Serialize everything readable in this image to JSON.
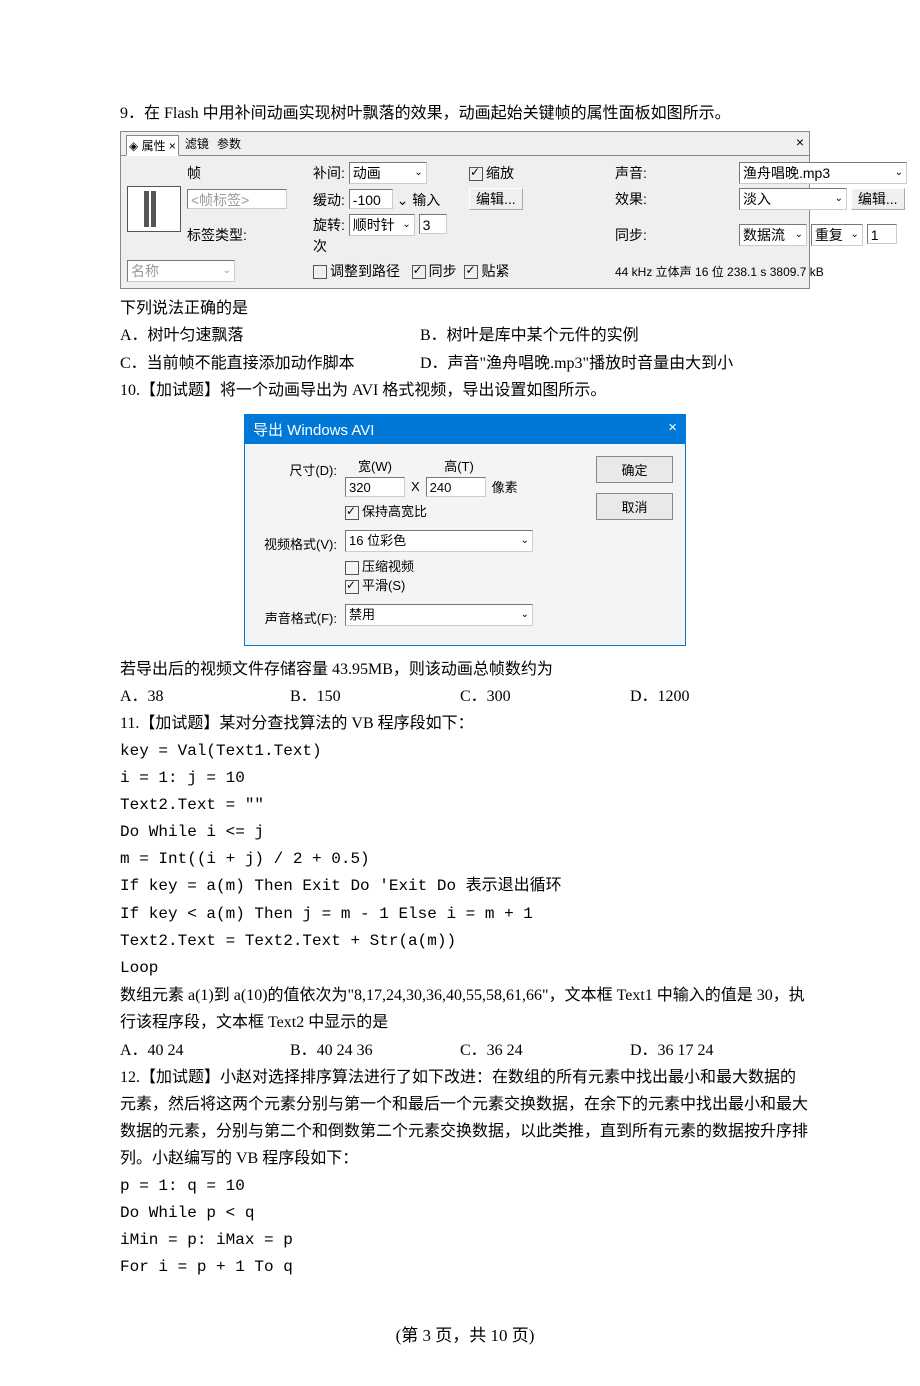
{
  "q9": {
    "text": "9．在 Flash 中用补间动画实现树叶飘落的效果，动画起始关键帧的属性面板如图所示。",
    "prompt": "下列说法正确的是",
    "opts": {
      "a": "A．树叶匀速飘落",
      "b": "B．树叶是库中某个元件的实例",
      "c": "C．当前帧不能直接添加动作脚本",
      "d": "D．声音\"渔舟唱晚.mp3\"播放时音量由大到小"
    }
  },
  "flash": {
    "tab1": "属性",
    "tab2": "滤镜",
    "tab3": "参数",
    "close": "×",
    "frame_label": "帧",
    "tag_placeholder": "<帧标签>",
    "tween_label": "补间:",
    "tween_value": "动画",
    "scale": "缩放",
    "ease_label": "缓动:",
    "ease_value": "-100",
    "ease_in": "输入",
    "edit": "编辑...",
    "rotate_label": "旋转:",
    "rotate_value": "顺时针",
    "rotate_count": "3",
    "rotate_unit": "次",
    "labeltype_label": "标签类型:",
    "name_placeholder": "名称",
    "adjust_path": "调整到路径",
    "sync": "同步",
    "snap": "贴紧",
    "sound_label": "声音:",
    "sound_value": "渔舟唱晚.mp3",
    "effect_label": "效果:",
    "effect_value": "淡入",
    "loop_label": "同步:",
    "sync_value": "数据流",
    "loop_value": "重复",
    "loop_count": "1",
    "info": "44 kHz 立体声 16 位 238.1 s 3809.7 kB"
  },
  "q10": {
    "text": "10.【加试题】将一个动画导出为 AVI 格式视频，导出设置如图所示。",
    "prompt": "若导出后的视频文件存储容量 43.95MB，则该动画总帧数约为",
    "opts": {
      "a": "A．38",
      "b": "B．150",
      "c": "C．300",
      "d": "D．1200"
    }
  },
  "avi": {
    "title": "导出 Windows AVI",
    "close": "×",
    "ok": "确定",
    "cancel": "取消",
    "size_label": "尺寸(D):",
    "w_label": "宽(W)",
    "h_label": "高(T)",
    "width": "320",
    "height": "240",
    "x": "X",
    "unit": "像素",
    "keep_ratio": "保持高宽比",
    "vf_label": "视频格式(V):",
    "vf_value": "16 位彩色",
    "compress": "压缩视频",
    "smooth": "平滑(S)",
    "af_label": "声音格式(F):",
    "af_value": "禁用"
  },
  "q11": {
    "text": "11.【加试题】某对分查找算法的 VB 程序段如下：",
    "code": [
      "key = Val(Text1.Text)",
      "i = 1: j = 10",
      "Text2.Text = \"\"",
      "Do While i <= j",
      "   m = Int((i + j) / 2 + 0.5)",
      "   If key = a(m) Then Exit Do   'Exit Do 表示退出循环",
      "   If key < a(m) Then j = m - 1 Else i = m + 1",
      "   Text2.Text = Text2.Text + Str(a(m))",
      "Loop"
    ],
    "desc": "数组元素 a(1)到 a(10)的值依次为\"8,17,24,30,36,40,55,58,61,66\"，文本框 Text1 中输入的值是 30，执行该程序段，文本框 Text2 中显示的是",
    "opts": {
      "a": "A．40 24",
      "b": "B．40 24 36",
      "c": "C．36 24",
      "d": "D．36 17 24"
    }
  },
  "q12": {
    "text": "12.【加试题】小赵对选择排序算法进行了如下改进：在数组的所有元素中找出最小和最大数据的元素，然后将这两个元素分别与第一个和最后一个元素交换数据，在余下的元素中找出最小和最大数据的元素，分别与第二个和倒数第二个元素交换数据，以此类推，直到所有元素的数据按升序排列。小赵编写的 VB 程序段如下：",
    "code": [
      "p = 1: q = 10",
      "Do While p < q",
      "   iMin = p: iMax = p",
      "   For i = p + 1 To q"
    ]
  },
  "footer": "(第 3 页，共 10 页)"
}
